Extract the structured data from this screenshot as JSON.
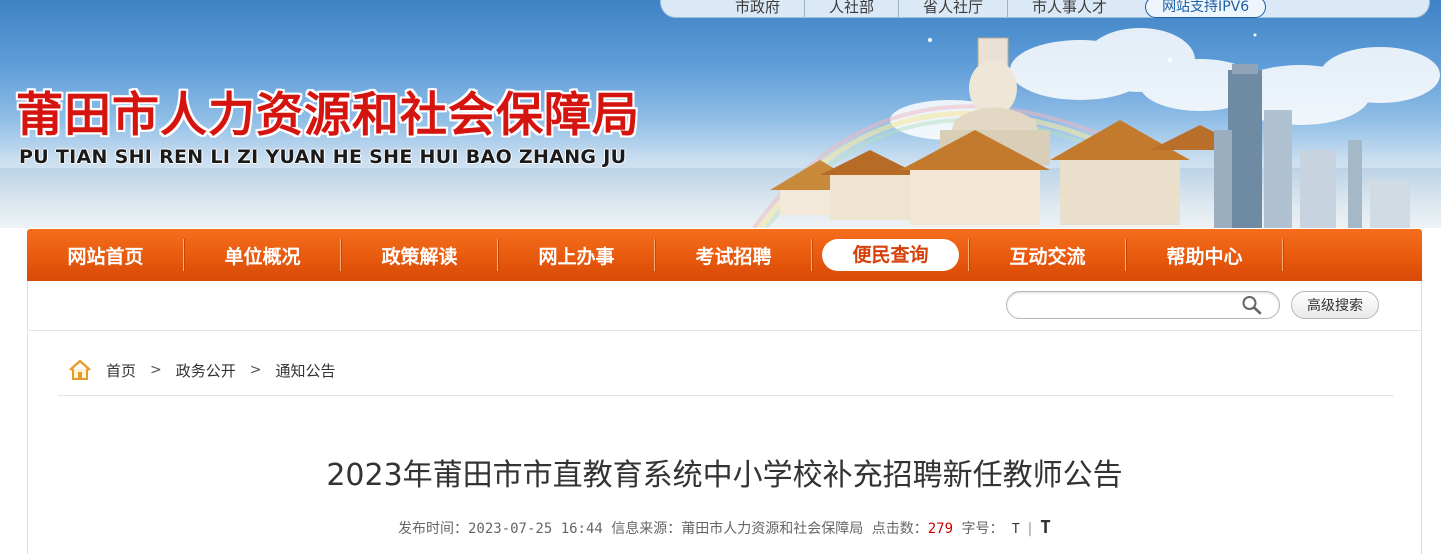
{
  "top_links": [
    "市政府",
    "人社部",
    "省人社厅",
    "市人事人才"
  ],
  "top_pill": "网站支持IPV6",
  "site": {
    "title": "莆田市人力资源和社会保障局",
    "pinyin": "PU TIAN SHI REN LI ZI YUAN HE SHE HUI BAO ZHANG JU"
  },
  "nav": [
    {
      "label": "网站首页"
    },
    {
      "label": "单位概况"
    },
    {
      "label": "政策解读"
    },
    {
      "label": "网上办事"
    },
    {
      "label": "考试招聘"
    },
    {
      "label": "便民查询",
      "active": true
    },
    {
      "label": "互动交流"
    },
    {
      "label": "帮助中心"
    }
  ],
  "search": {
    "value": "",
    "advanced_label": "高级搜索"
  },
  "breadcrumb": [
    "首页",
    "政务公开",
    "通知公告"
  ],
  "article": {
    "title": "2023年莆田市市直教育系统中小学校补充招聘新任教师公告",
    "publish_label": "发布时间：",
    "publish_time": "2023-07-25 16:44",
    "source_label": "信息来源：",
    "source": "莆田市人力资源和社会保障局",
    "hits_label": "点击数：",
    "hits": "279",
    "fontsize_label": "字号：",
    "font_small": "T",
    "font_divider": "|",
    "font_large": "T"
  },
  "colors": {
    "nav_orange": "#e85a0e",
    "title_red": "#d6140f",
    "hits_red": "#cc0000"
  }
}
